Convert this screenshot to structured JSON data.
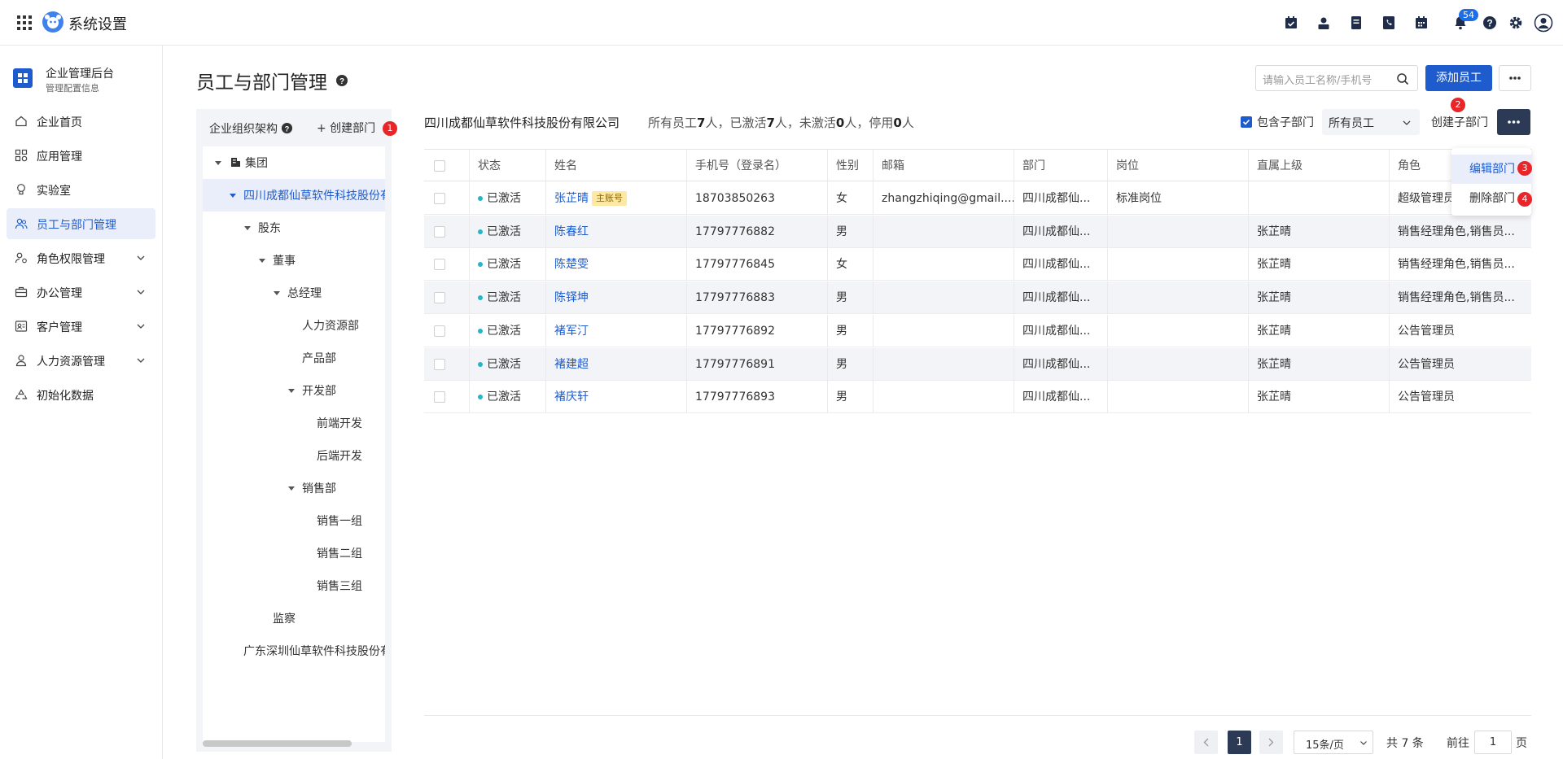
{
  "app": {
    "title": "系统设置",
    "notification_count": "54"
  },
  "sidebar": {
    "header_title": "企业管理后台",
    "header_subtitle": "管理配置信息",
    "items": [
      {
        "label": "企业首页"
      },
      {
        "label": "应用管理"
      },
      {
        "label": "实验室"
      },
      {
        "label": "员工与部门管理"
      },
      {
        "label": "角色权限管理"
      },
      {
        "label": "办公管理"
      },
      {
        "label": "客户管理"
      },
      {
        "label": "人力资源管理"
      },
      {
        "label": "初始化数据"
      }
    ]
  },
  "page": {
    "title": "员工与部门管理",
    "search_placeholder": "请输入员工名称/手机号",
    "add_employee": "添加员工"
  },
  "tree": {
    "header": "企业组织架构",
    "create_dept": "+ 创建部门",
    "nodes": [
      {
        "label": "集团"
      },
      {
        "label": "四川成都仙草软件科技股份有限公司"
      },
      {
        "label": "股东"
      },
      {
        "label": "董事"
      },
      {
        "label": "总经理"
      },
      {
        "label": "人力资源部"
      },
      {
        "label": "产品部"
      },
      {
        "label": "开发部"
      },
      {
        "label": "前端开发"
      },
      {
        "label": "后端开发"
      },
      {
        "label": "销售部"
      },
      {
        "label": "销售一组"
      },
      {
        "label": "销售二组"
      },
      {
        "label": "销售三组"
      },
      {
        "label": "监察"
      },
      {
        "label": "广东深圳仙草软件科技股份有限公司"
      }
    ]
  },
  "dept": {
    "name": "四川成都仙草软件科技股份有限公司",
    "stats": {
      "p1": "所有员工",
      "all": "7",
      "p2": "人，已激活",
      "active": "7",
      "p3": "人，未激活",
      "inactive": "0",
      "p4": "人，停用",
      "disabled": "0",
      "p5": "人"
    },
    "include_sub": "包含子部门",
    "include_sub_checked": true,
    "filter": "所有员工",
    "create_sub": "创建子部门"
  },
  "table": {
    "columns": [
      "状态",
      "姓名",
      "手机号（登录名）",
      "性别",
      "邮箱",
      "部门",
      "岗位",
      "直属上级",
      "角色"
    ],
    "main_tag": "主账号",
    "rows": [
      {
        "status": "已激活",
        "name": "张芷晴",
        "main": true,
        "phone": "18703850263",
        "gender": "女",
        "email": "zhangzhiqing@gmail....",
        "dept": "四川成都仙...",
        "post": "标准岗位",
        "manager": "",
        "role": "超级管理员"
      },
      {
        "status": "已激活",
        "name": "陈春红",
        "main": false,
        "phone": "17797776882",
        "gender": "男",
        "email": "",
        "dept": "四川成都仙...",
        "post": "",
        "manager": "张芷晴",
        "role": "销售经理角色,销售员..."
      },
      {
        "status": "已激活",
        "name": "陈楚雯",
        "main": false,
        "phone": "17797776845",
        "gender": "女",
        "email": "",
        "dept": "四川成都仙...",
        "post": "",
        "manager": "张芷晴",
        "role": "销售经理角色,销售员..."
      },
      {
        "status": "已激活",
        "name": "陈铎坤",
        "main": false,
        "phone": "17797776883",
        "gender": "男",
        "email": "",
        "dept": "四川成都仙...",
        "post": "",
        "manager": "张芷晴",
        "role": "销售经理角色,销售员..."
      },
      {
        "status": "已激活",
        "name": "褚军汀",
        "main": false,
        "phone": "17797776892",
        "gender": "男",
        "email": "",
        "dept": "四川成都仙...",
        "post": "",
        "manager": "张芷晴",
        "role": "公告管理员"
      },
      {
        "status": "已激活",
        "name": "褚建超",
        "main": false,
        "phone": "17797776891",
        "gender": "男",
        "email": "",
        "dept": "四川成都仙...",
        "post": "",
        "manager": "张芷晴",
        "role": "公告管理员"
      },
      {
        "status": "已激活",
        "name": "褚庆轩",
        "main": false,
        "phone": "17797776893",
        "gender": "男",
        "email": "",
        "dept": "四川成都仙...",
        "post": "",
        "manager": "张芷晴",
        "role": "公告管理员"
      }
    ]
  },
  "dropdown": {
    "edit": "编辑部门",
    "delete": "删除部门"
  },
  "badges": [
    "1",
    "2",
    "3",
    "4"
  ],
  "pagination": {
    "current": "1",
    "size": "15条/页",
    "total": "共 7 条",
    "goto_label": "前往",
    "goto_value": "1",
    "goto_unit": "页"
  },
  "colors": {
    "primary": "#1e5ccd",
    "dark": "#2d3a55",
    "badge": "#e8262a",
    "active_dot": "#23b6c6"
  }
}
